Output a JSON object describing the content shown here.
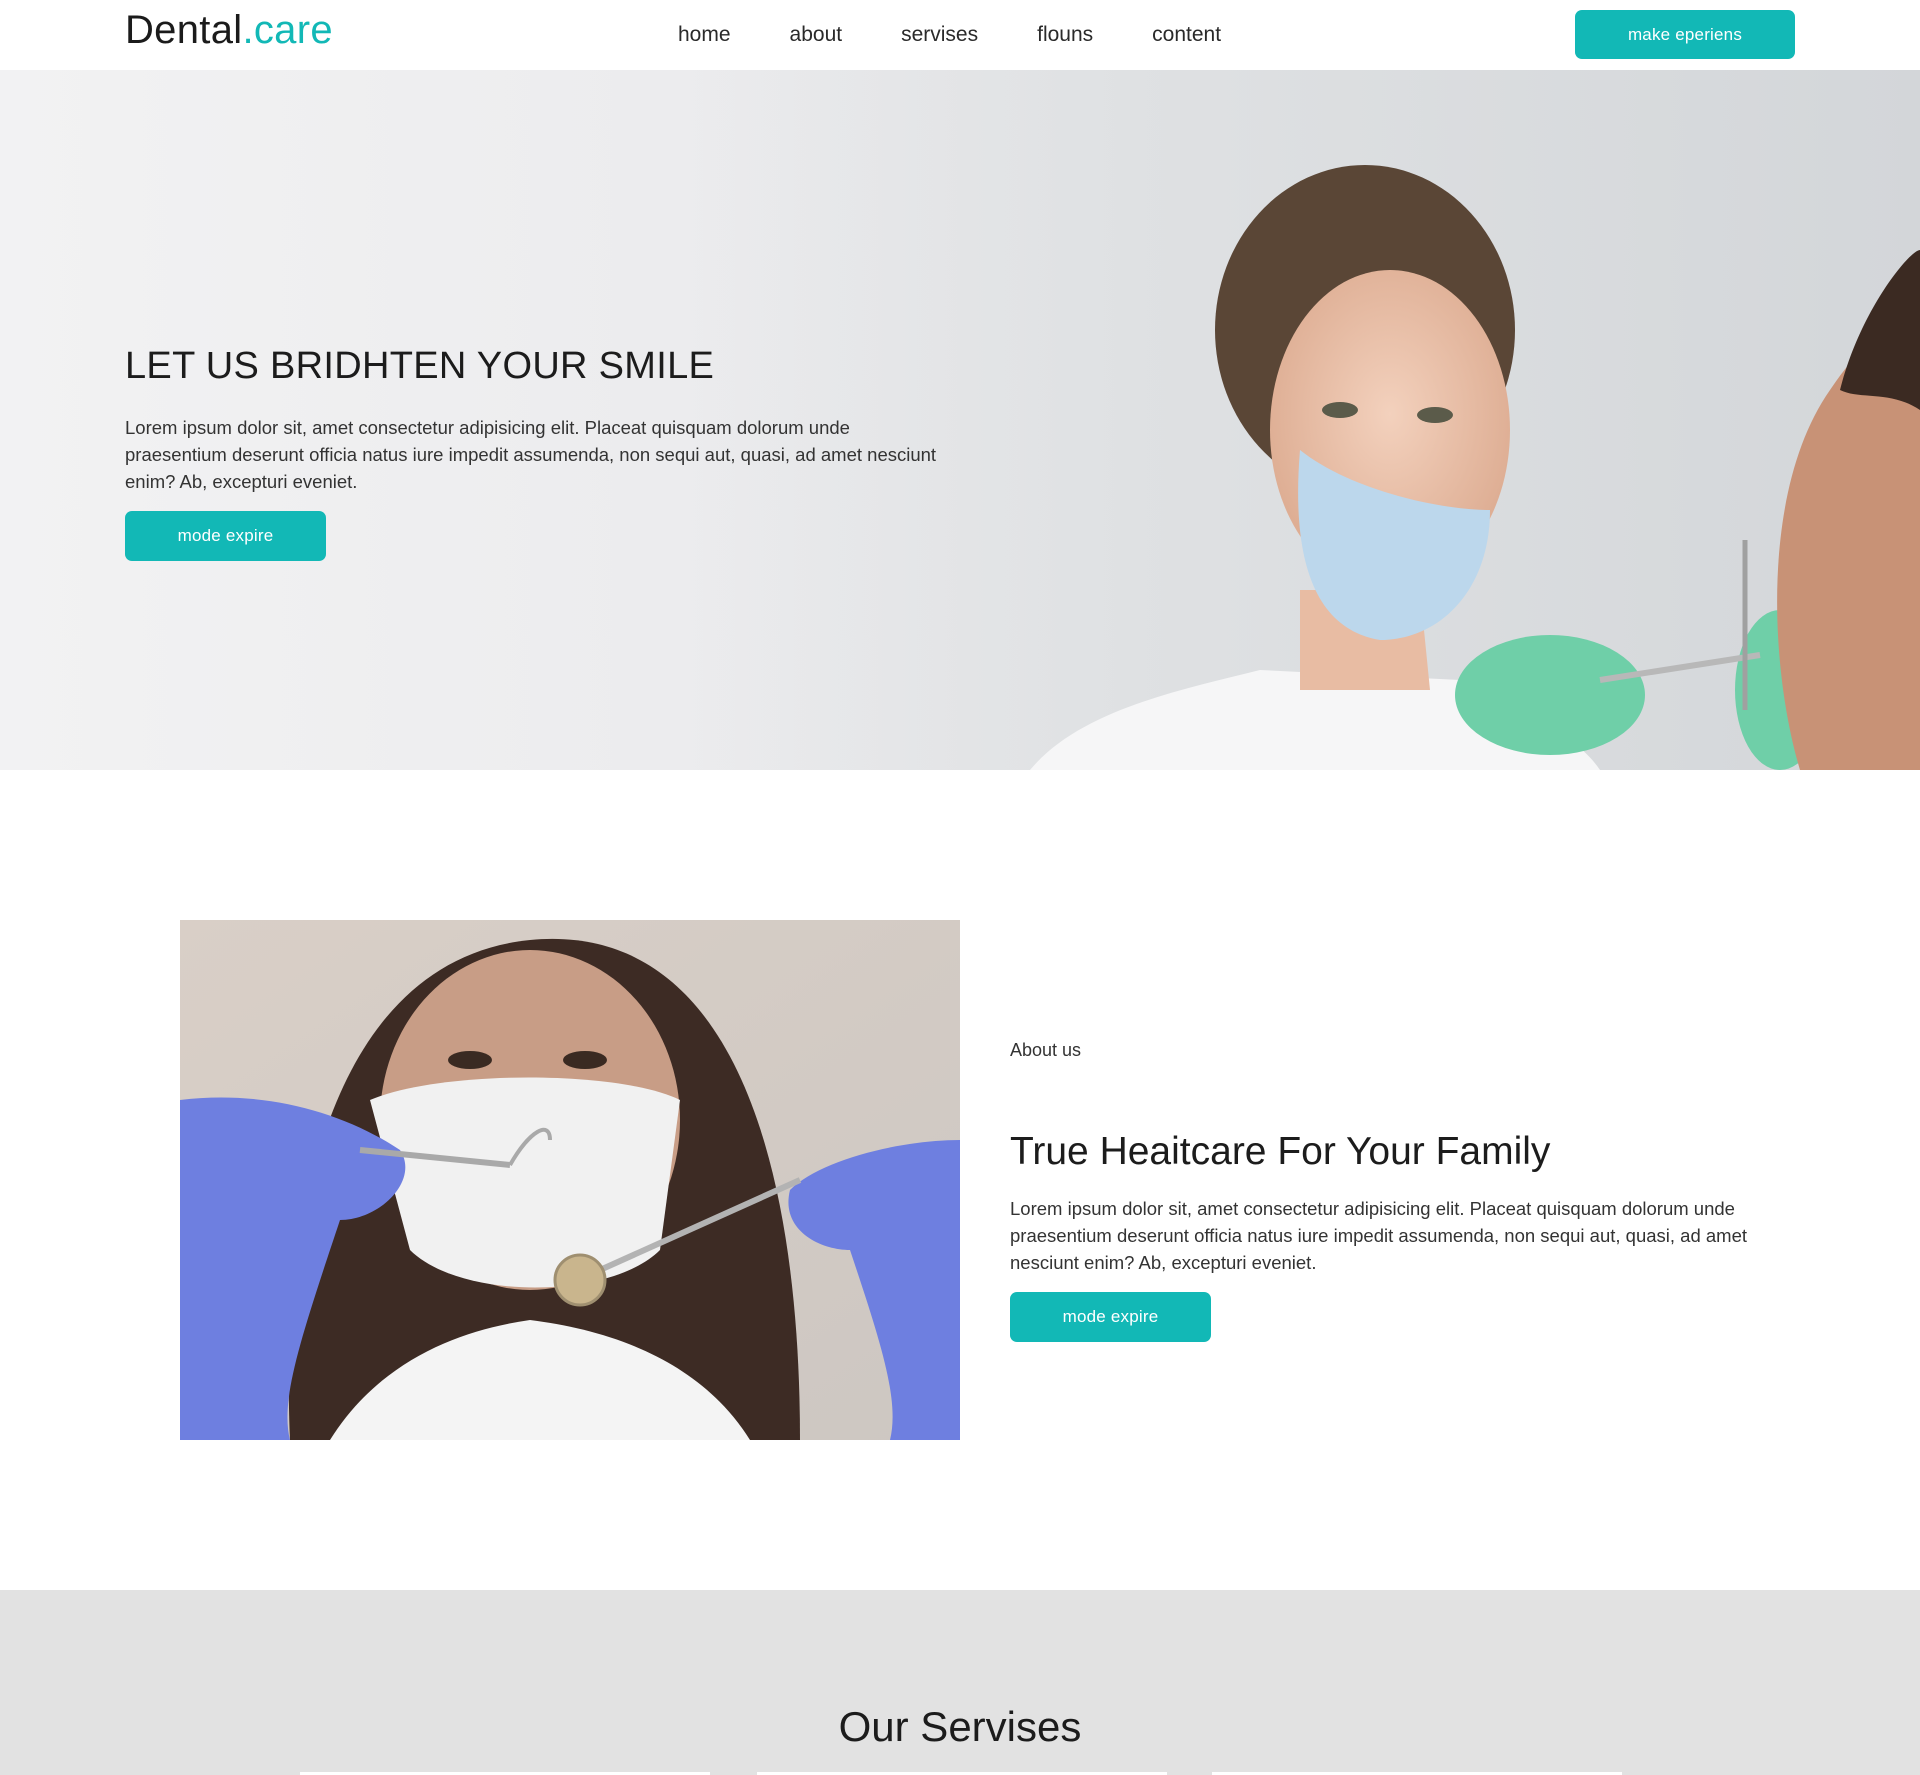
{
  "brand": {
    "name_main": "Dental",
    "name_accent": ".care",
    "accent_color": "#12b8b6"
  },
  "nav": {
    "items": [
      "home",
      "about",
      "servises",
      "flouns",
      "content"
    ],
    "cta_label": "make eperiens"
  },
  "hero": {
    "title": "LET US BRIDHTEN YOUR SMILE",
    "text": "Lorem ipsum dolor sit, amet consectetur adipisicing elit. Placeat quisquam dolorum unde praesentium deserunt officia natus iure impedit assumenda, non sequi aut, quasi, ad amet nesciunt enim? Ab, excepturi eveniet.",
    "button_label": "mode expire"
  },
  "about": {
    "label": "About us",
    "title": "True Heaitcare For Your Family",
    "text": "Lorem ipsum dolor sit, amet consectetur adipisicing elit. Placeat quisquam dolorum unde praesentium deserunt officia natus iure impedit assumenda, non sequi aut, quasi, ad amet nesciunt enim? Ab, excepturi eveniet.",
    "button_label": "mode expire"
  },
  "services": {
    "title": "Our Servises"
  }
}
